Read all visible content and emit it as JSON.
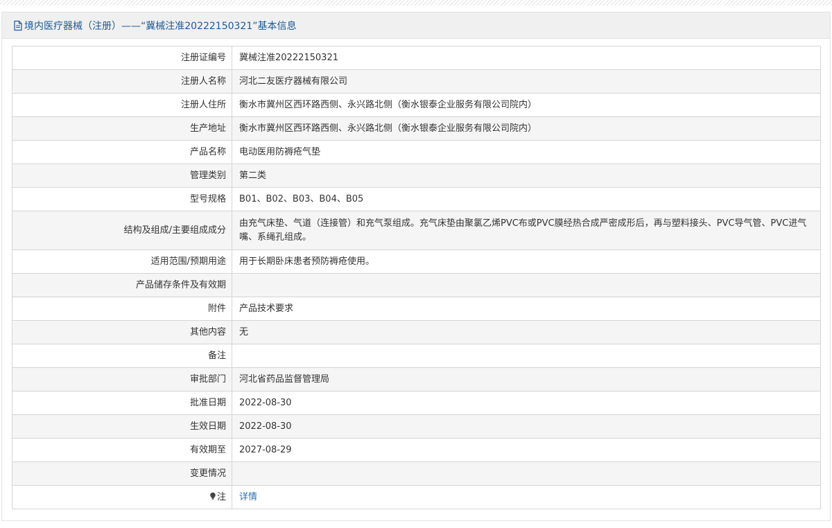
{
  "header": {
    "title": "境内医疗器械（注册）——“冀械注准20222150321”基本信息"
  },
  "rows": [
    {
      "label": "注册证编号",
      "value": "冀械注准20222150321"
    },
    {
      "label": "注册人名称",
      "value": "河北二友医疗器械有限公司"
    },
    {
      "label": "注册人住所",
      "value": "衡水市冀州区西环路西侧、永兴路北侧（衡水银泰企业服务有限公司院内）"
    },
    {
      "label": "生产地址",
      "value": "衡水市冀州区西环路西侧、永兴路北侧（衡水银泰企业服务有限公司院内）"
    },
    {
      "label": "产品名称",
      "value": "电动医用防褥疮气垫"
    },
    {
      "label": "管理类别",
      "value": "第二类"
    },
    {
      "label": "型号规格",
      "value": "B01、B02、B03、B04、B05"
    },
    {
      "label": "结构及组成/主要组成成分",
      "value": "由充气床垫、气道（连接管）和充气泵组成。充气床垫由聚氯乙烯PVC布或PVC膜经热合成严密成形后，再与塑料接头、PVC导气管、PVC进气嘴、系绳孔组成。"
    },
    {
      "label": "适用范围/预期用途",
      "value": "用于长期卧床患者预防褥疮使用。"
    },
    {
      "label": "产品储存条件及有效期",
      "value": ""
    },
    {
      "label": "附件",
      "value": "产品技术要求"
    },
    {
      "label": "其他内容",
      "value": "无"
    },
    {
      "label": "备注",
      "value": ""
    },
    {
      "label": "审批部门",
      "value": "河北省药品监督管理局"
    },
    {
      "label": "批准日期",
      "value": "2022-08-30"
    },
    {
      "label": "生效日期",
      "value": "2022-08-30"
    },
    {
      "label": "有效期至",
      "value": "2027-08-29"
    },
    {
      "label": "变更情况",
      "value": ""
    }
  ],
  "note_row": {
    "label": "注",
    "link_text": "详情",
    "icon": "lightbulb-icon"
  },
  "colors": {
    "header_text": "#1c5a96",
    "link": "#2a6fb5",
    "border": "#d4d4d4",
    "row_alt": "#f5f5f5"
  }
}
